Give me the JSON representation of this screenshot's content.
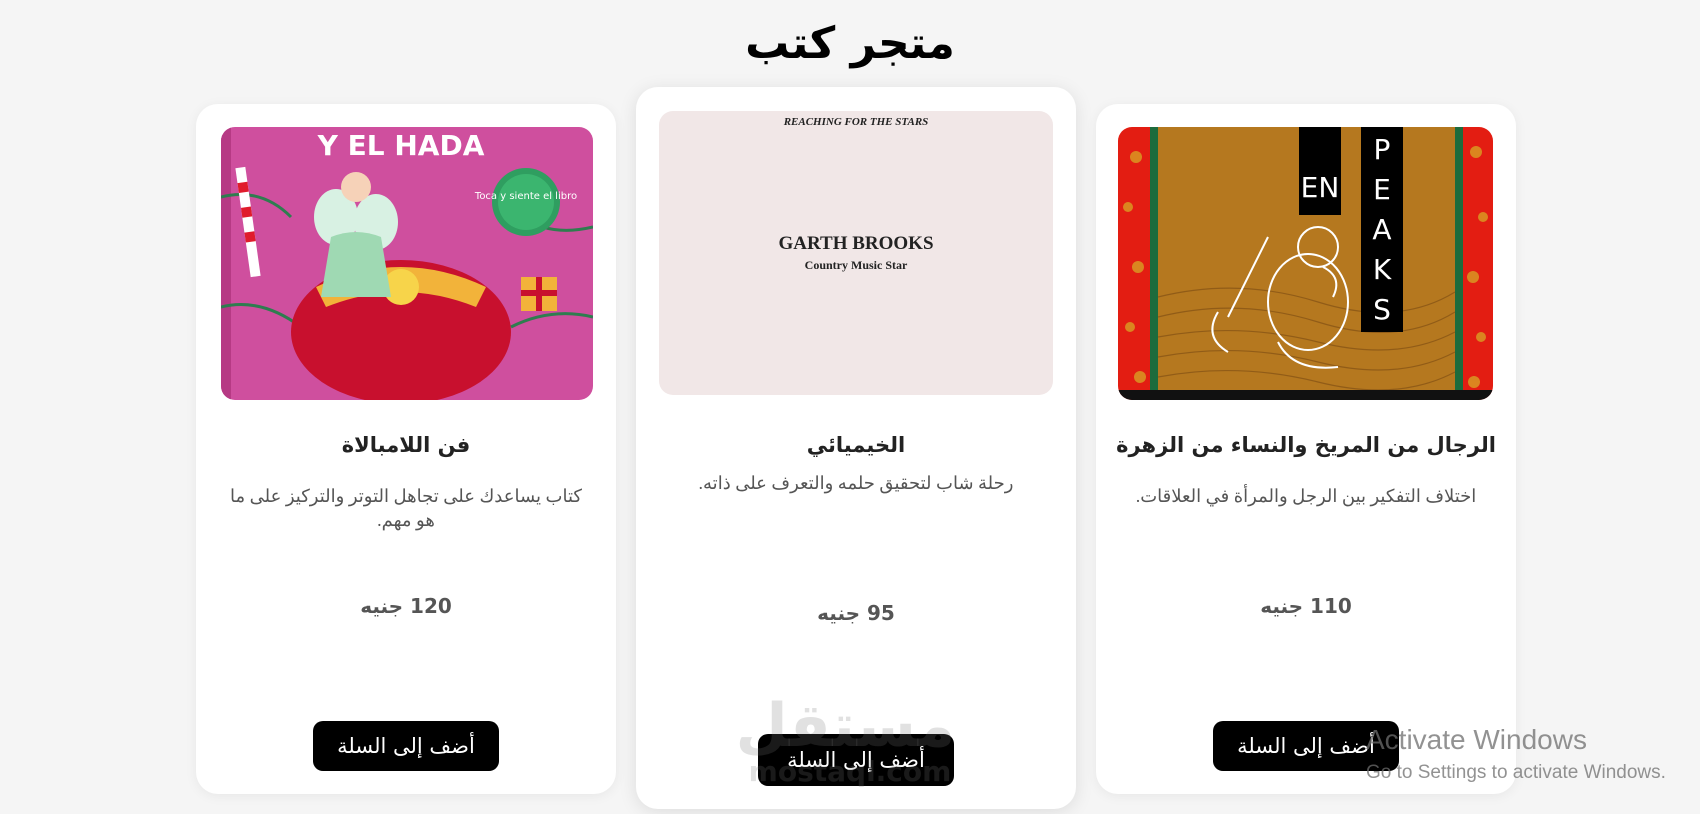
{
  "page": {
    "title": "متجر كتب"
  },
  "books": [
    {
      "title": "الرجال من المريخ والنساء من الزهرة",
      "description": "اختلاف التفكير بين الرجل والمرأة في العلاقات.",
      "price": "110 جنيه",
      "button_label": "أضف إلى السلة",
      "cover": {
        "text_1": "EN",
        "text_2": "PEAKS"
      }
    },
    {
      "title": "الخيميائي",
      "description": "رحلة شاب لتحقيق حلمه والتعرف على ذاته.",
      "price": "95 جنيه",
      "button_label": "أضف إلى السلة",
      "cover": {
        "top_line": "REACHING FOR THE STARS",
        "name": "GARTH BROOKS",
        "subtitle": "Country Music Star"
      }
    },
    {
      "title": "فن اللامبالاة",
      "description": "كتاب يساعدك على تجاهل التوتر والتركيز على ما هو مهم.",
      "price": "120 جنيه",
      "button_label": "أضف إلى السلة",
      "cover": {
        "headline": "Y EL HADA",
        "badge": "Toca y siente el libro"
      }
    }
  ],
  "watermark": {
    "arabic": "مستقل",
    "latin": "mostaql.com"
  },
  "os_notice": {
    "line_1": "Activate Windows",
    "line_2": "Go to Settings to activate Windows."
  },
  "colors": {
    "background": "#f5f5f5",
    "card": "#ffffff",
    "button": "#000000"
  }
}
